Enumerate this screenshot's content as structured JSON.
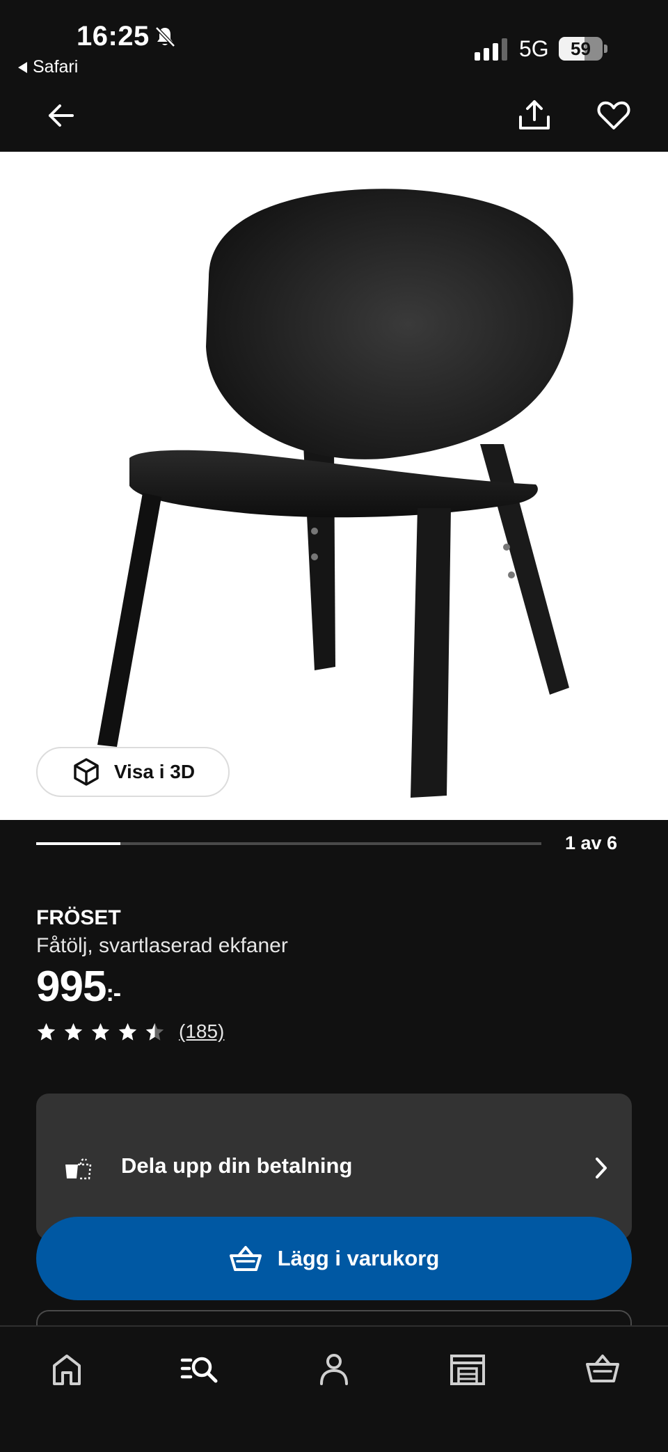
{
  "status_bar": {
    "time": "16:25",
    "back_app": "Safari",
    "network": "5G",
    "battery_percent": 59
  },
  "toolbar": {
    "back_icon": "arrow-left-icon",
    "share_icon": "share-icon",
    "favorite_icon": "heart-icon"
  },
  "gallery": {
    "view_3d_label": "Visa i 3D",
    "counter": "1 av 6",
    "current_index": 1,
    "total": 6
  },
  "product": {
    "name": "FRÖSET",
    "description": "Fåtölj, svartlaserad ekfaner",
    "price": "995",
    "price_suffix": ":-",
    "rating": 4.5,
    "max_rating": 5,
    "review_count": "(185)"
  },
  "payment": {
    "label": "Dela upp din betalning",
    "icon": "split-payment-icon"
  },
  "cart": {
    "add_label": "Lägg i varukorg",
    "icon": "basket-icon"
  },
  "tabbar": {
    "items": [
      {
        "name": "home",
        "icon": "home-icon"
      },
      {
        "name": "search",
        "icon": "search-list-icon"
      },
      {
        "name": "profile",
        "icon": "person-icon"
      },
      {
        "name": "stores",
        "icon": "store-icon"
      },
      {
        "name": "cart",
        "icon": "basket-icon"
      }
    ]
  },
  "colors": {
    "background": "#111111",
    "card": "#333333",
    "primary_button": "#0058a3",
    "text": "#ffffff"
  }
}
